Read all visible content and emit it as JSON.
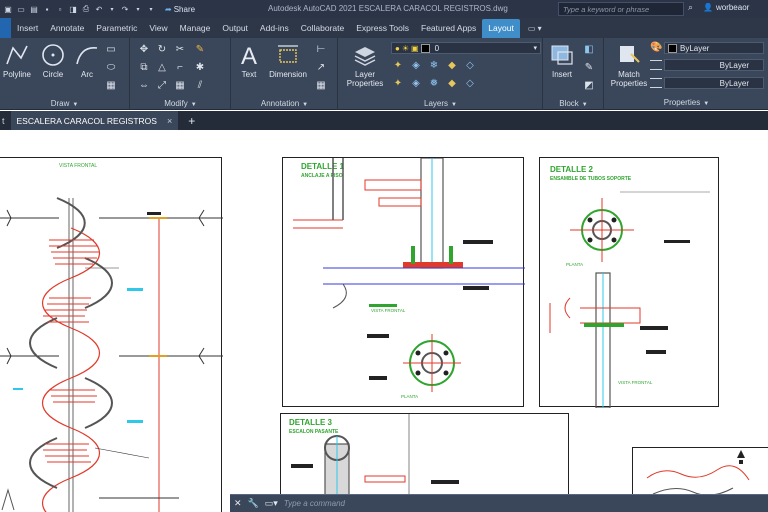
{
  "titlebar": {
    "share_label": "Share",
    "title": "Autodesk AutoCAD 2021   ESCALERA CARACOL REGISTROS.dwg",
    "search_placeholder": "Type a keyword or phrase",
    "user": "worbeaor"
  },
  "tabs": [
    "Insert",
    "Annotate",
    "Parametric",
    "View",
    "Manage",
    "Output",
    "Add-ins",
    "Collaborate",
    "Express Tools",
    "Featured Apps",
    "Layout"
  ],
  "active_tab": "Layout",
  "ribbon": {
    "draw": {
      "title": "Draw",
      "tools": [
        "Polyline",
        "Circle",
        "Arc"
      ]
    },
    "modify": {
      "title": "Modify"
    },
    "annotation": {
      "title": "Annotation",
      "tools": [
        "Text",
        "Dimension"
      ]
    },
    "layers": {
      "title": "Layers",
      "tool": "Layer Properties",
      "layer_value": "0"
    },
    "block": {
      "title": "Block",
      "tool": "Insert"
    },
    "properties": {
      "title": "Properties",
      "tool": "Match Properties",
      "color": "ByLayer",
      "linetype": "ByLayer",
      "lineweight": "ByLayer"
    }
  },
  "file_tabs": {
    "edge_label": "t",
    "active_file": "ESCALERA CARACOL REGISTROS",
    "close_symbol": "×",
    "new_symbol": "+"
  },
  "drawing": {
    "front_view_label": "VISTA FRONTAL",
    "detail1_title": "DETALLE 1",
    "detail1_sub": "ANCLAJE A PISO",
    "detail1_caption": "VISTA FRONTAL",
    "detail1_caption2": "PLANTA",
    "detail2_title": "DETALLE 2",
    "detail2_sub": "ENSAMBLE DE TUBOS SOPORTE",
    "detail2_caption": "PLANTA",
    "detail2_caption2": "VISTA FRONTAL",
    "detail3_title": "DETALLE 3",
    "detail3_sub": "ESCALON PASANTE"
  },
  "command_line": {
    "placeholder": "Type a command"
  },
  "colors": {
    "accent": "#3f8ec9",
    "titlebar": "#2b3547",
    "ribbon": "#3a4659",
    "stair_red": "#e03a2a",
    "detail_green": "#2fa52f"
  }
}
